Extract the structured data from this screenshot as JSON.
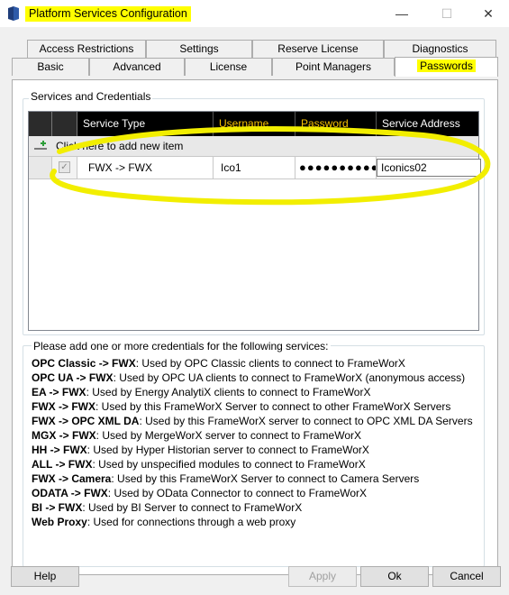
{
  "window": {
    "title": "Platform Services Configuration",
    "minimize_glyph": "—",
    "maximize_glyph": "☐",
    "close_glyph": "✕"
  },
  "tabs_row1": [
    "Access Restrictions",
    "Settings",
    "Reserve License",
    "Diagnostics"
  ],
  "tabs_row2": [
    "Basic",
    "Advanced",
    "License",
    "Point Managers",
    "Passwords"
  ],
  "active_tab": "Passwords",
  "group": {
    "label": "Services and Credentials"
  },
  "grid": {
    "columns": [
      "Service Type",
      "Username",
      "Password",
      "Service Address"
    ],
    "add_row_text": "Click here to add new item",
    "rows": [
      {
        "checked": true,
        "service_type": "FWX -> FWX",
        "username": "Ico1",
        "password": "●●●●●●●●●●●",
        "service_address": "Iconics02"
      }
    ]
  },
  "info": {
    "heading": "Please add one or more credentials for the following services:",
    "items": [
      {
        "key": "OPC Classic -> FWX",
        "desc": ": Used by OPC Classic clients to connect to FrameWorX"
      },
      {
        "key": "OPC UA -> FWX",
        "desc": ": Used by OPC UA clients to connect to FrameWorX (anonymous access)"
      },
      {
        "key": "EA -> FWX",
        "desc": ": Used by Energy AnalytiX clients to connect to FrameWorX"
      },
      {
        "key": "FWX -> FWX",
        "desc": ": Used by this FrameWorX Server to connect to other FrameWorX Servers"
      },
      {
        "key": "FWX -> OPC XML DA",
        "desc": ": Used by this FrameWorX server to connect to OPC XML DA Servers"
      },
      {
        "key": "MGX -> FWX",
        "desc": ": Used by MergeWorX server to connect to FrameWorX"
      },
      {
        "key": "HH -> FWX",
        "desc": ": Used by Hyper Historian server to connect to FrameWorX"
      },
      {
        "key": "ALL -> FWX",
        "desc": ": Used by unspecified modules to connect to FrameWorX"
      },
      {
        "key": "FWX -> Camera",
        "desc": ": Used by this FrameWorX Server to connect to Camera Servers"
      },
      {
        "key": "ODATA -> FWX",
        "desc": ": Used by OData Connector to connect to FrameWorX"
      },
      {
        "key": "BI -> FWX",
        "desc": ": Used by BI Server to connect to FrameWorX"
      },
      {
        "key": "Web Proxy",
        "desc": ": Used for connections through a web proxy"
      }
    ]
  },
  "buttons": {
    "help": "Help",
    "apply": "Apply",
    "ok": "Ok",
    "cancel": "Cancel"
  },
  "colors": {
    "highlight": "#ffff00",
    "header_bg": "#000000",
    "header_gold": "#f5c000",
    "dialog_bg": "#f0f0f0"
  },
  "icons": [
    "app-icon",
    "minimize-icon",
    "maximize-icon",
    "close-icon",
    "add-row-icon",
    "checkbox-icon"
  ]
}
